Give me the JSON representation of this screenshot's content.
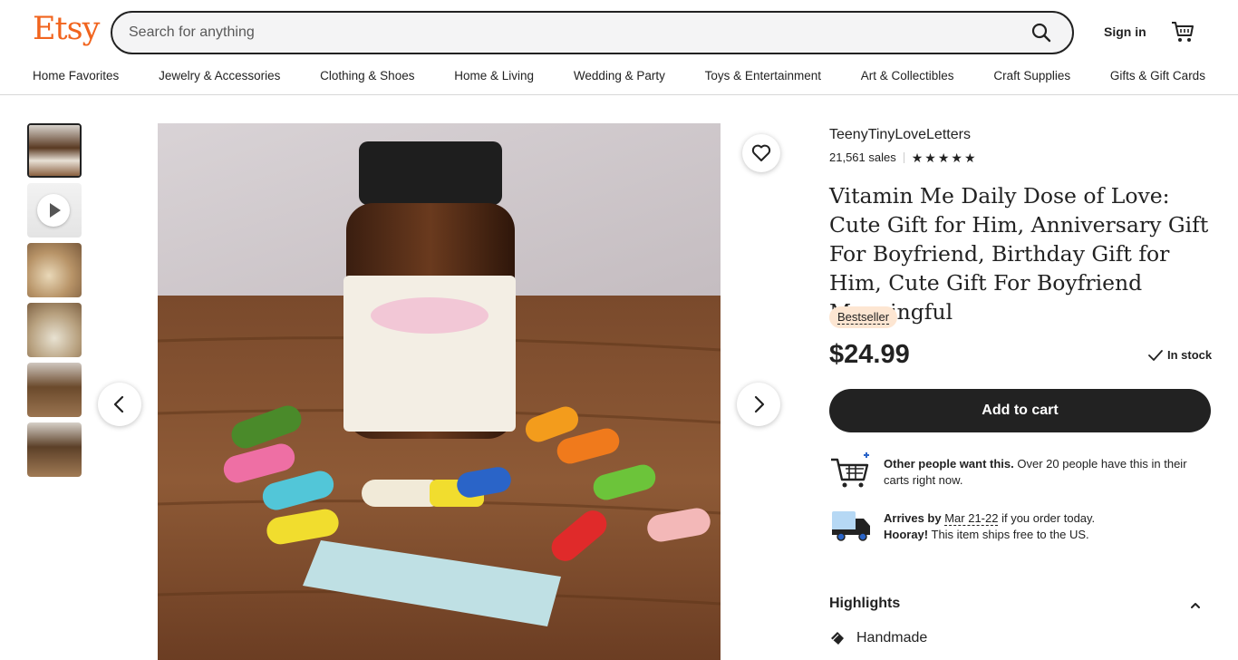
{
  "brand": {
    "logo_text": "Etsy",
    "accent_color": "#f1641e"
  },
  "search": {
    "placeholder": "Search for anything"
  },
  "header": {
    "sign_in_label": "Sign in"
  },
  "nav": {
    "items": [
      "Home Favorites",
      "Jewelry & Accessories",
      "Clothing & Shoes",
      "Home & Living",
      "Wedding & Party",
      "Toys & Entertainment",
      "Art & Collectibles",
      "Craft Supplies",
      "Gifts & Gift Cards"
    ]
  },
  "gallery": {
    "thumbnails": [
      {
        "type": "image",
        "selected": true
      },
      {
        "type": "video",
        "selected": false
      },
      {
        "type": "image",
        "selected": false
      },
      {
        "type": "image",
        "selected": false
      },
      {
        "type": "image",
        "selected": false
      },
      {
        "type": "image",
        "selected": false
      }
    ],
    "main_image_alt": "product photo"
  },
  "listing": {
    "shop_name": "TeenyTinyLoveLetters",
    "sales": "21,561 sales",
    "rating_stars": 5,
    "title": "Vitamin Me Daily Dose of Love: Cute Gift for Him, Anniversary Gift For Boyfriend, Birthday Gift for Him, Cute Gift For Boyfriend Meaningful",
    "badge": "Bestseller",
    "price": "$24.99",
    "stock": "In stock",
    "add_to_cart_label": "Add to cart"
  },
  "demand": {
    "bold": "Other people want this.",
    "text": " Over 20 people have this in their carts right now."
  },
  "shipping": {
    "arrives_label": "Arrives by",
    "date": "Mar 21-22",
    "arrives_suffix": " if you order today.",
    "hooray_bold": "Hooray!",
    "hooray_text": " This item ships free to the US."
  },
  "highlights": {
    "title": "Highlights",
    "items": [
      "Handmade"
    ]
  }
}
